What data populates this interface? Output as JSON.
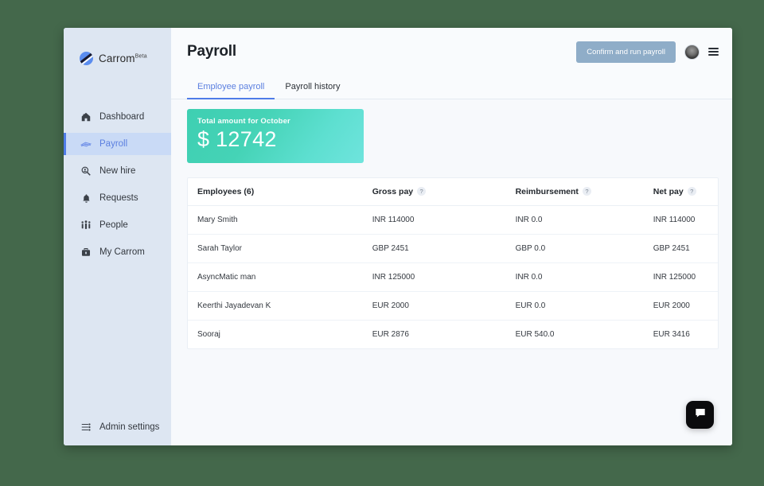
{
  "brand": {
    "name": "Carrom",
    "beta": "Beta",
    "logo_icon": "carrom-disc-icon"
  },
  "sidebar": {
    "items": [
      {
        "label": "Dashboard",
        "icon": "home-icon",
        "active": false
      },
      {
        "label": "Payroll",
        "icon": "money-stack-icon",
        "active": true
      },
      {
        "label": "New hire",
        "icon": "search-user-icon",
        "active": false
      },
      {
        "label": "Requests",
        "icon": "bell-icon",
        "active": false
      },
      {
        "label": "People",
        "icon": "people-icon",
        "active": false
      },
      {
        "label": "My Carrom",
        "icon": "briefcase-icon",
        "active": false
      }
    ],
    "admin": {
      "label": "Admin settings",
      "icon": "sliders-icon"
    }
  },
  "header": {
    "title": "Payroll",
    "cta_label": "Confirm and run payroll",
    "avatar_icon": "user-avatar",
    "menu_icon": "hamburger-menu-icon"
  },
  "tabs": [
    {
      "label": "Employee payroll",
      "active": true
    },
    {
      "label": "Payroll history",
      "active": false
    }
  ],
  "total_card": {
    "label": "Total amount for October",
    "currency": "$",
    "amount": "12742",
    "value_text": "$ 12742"
  },
  "table": {
    "columns": [
      {
        "label": "Employees (6)",
        "help": false
      },
      {
        "label": "Gross pay",
        "help": true,
        "help_icon": "question-mark-icon"
      },
      {
        "label": "Reimbursement",
        "help": true,
        "help_icon": "question-mark-icon"
      },
      {
        "label": "Net pay",
        "help": true,
        "help_icon": "question-mark-icon"
      }
    ],
    "rows": [
      {
        "employee": "Mary Smith",
        "gross": "INR 114000",
        "reimbursement": "INR 0.0",
        "net": "INR 114000"
      },
      {
        "employee": "Sarah Taylor",
        "gross": "GBP 2451",
        "reimbursement": "GBP 0.0",
        "net": "GBP 2451"
      },
      {
        "employee": "AsyncMatic man",
        "gross": "INR 125000",
        "reimbursement": "INR 0.0",
        "net": "INR 125000"
      },
      {
        "employee": "Keerthi Jayadevan K",
        "gross": "EUR 2000",
        "reimbursement": "EUR 0.0",
        "net": "EUR 2000"
      },
      {
        "employee": "Sooraj",
        "gross": "EUR 2876",
        "reimbursement": "EUR 540.0",
        "net": "EUR 3416"
      }
    ]
  },
  "chat": {
    "icon": "chat-bubble-icon"
  },
  "colors": {
    "page_background": "#44684b",
    "sidebar": "#dde6f2",
    "accent_blue": "#4f7ce8",
    "active_nav_bg": "#c9daf6",
    "cta_button": "#8fadc8",
    "card_gradient_start": "#3ecfb2",
    "card_gradient_end": "#6fe4dd",
    "chat_fab": "#0b0b0d"
  }
}
